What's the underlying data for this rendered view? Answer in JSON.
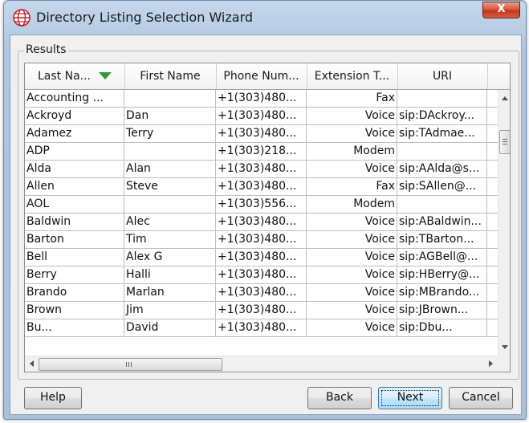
{
  "window": {
    "title": "Directory Listing Selection Wizard",
    "close_label": "X"
  },
  "group": {
    "label": "Results"
  },
  "table": {
    "columns": [
      {
        "label": "Last Na...",
        "sorted": "descending"
      },
      {
        "label": "First Name"
      },
      {
        "label": "Phone Num..."
      },
      {
        "label": "Extension T..."
      },
      {
        "label": "URI"
      }
    ],
    "rows": [
      [
        "Accounting ...",
        "",
        "+1(303)480...",
        "Fax",
        ""
      ],
      [
        "Ackroyd",
        "Dan",
        "+1(303)480...",
        "Voice",
        "sip:DAckroy..."
      ],
      [
        "Adamez",
        "Terry",
        "+1(303)480...",
        "Voice",
        "sip:TAdmae..."
      ],
      [
        "ADP",
        "",
        "+1(303)218...",
        "Modem",
        ""
      ],
      [
        "Alda",
        "Alan",
        "+1(303)480...",
        "Voice",
        "sip:AAlda@s..."
      ],
      [
        "Allen",
        "Steve",
        "+1(303)480...",
        "Fax",
        "sip:SAllen@..."
      ],
      [
        "AOL",
        "",
        "+1(303)556...",
        "Modem",
        ""
      ],
      [
        "Baldwin",
        "Alec",
        "+1(303)480...",
        "Voice",
        "sip:ABaldwin..."
      ],
      [
        "Barton",
        "Tim",
        "+1(303)480...",
        "Voice",
        "sip:TBarton..."
      ],
      [
        "Bell",
        "Alex G",
        "+1(303)480...",
        "Voice",
        "sip:AGBell@..."
      ],
      [
        "Berry",
        "Halli",
        "+1(303)480...",
        "Voice",
        "sip:HBerry@..."
      ],
      [
        "Brando",
        "Marlan",
        "+1(303)480...",
        "Voice",
        "sip:MBrando..."
      ],
      [
        "Brown",
        "Jim",
        "+1(303)480...",
        "Voice",
        "sip:JBrown..."
      ],
      [
        "Bu...",
        "David",
        "+1(303)480...",
        "Voice",
        "sip:Dbu..."
      ]
    ]
  },
  "buttons": {
    "help": "Help",
    "back": "Back",
    "next": "Next",
    "cancel": "Cancel"
  },
  "colors": {
    "sort_indicator": "#2f9a2f",
    "close_button": "#c4341a"
  }
}
